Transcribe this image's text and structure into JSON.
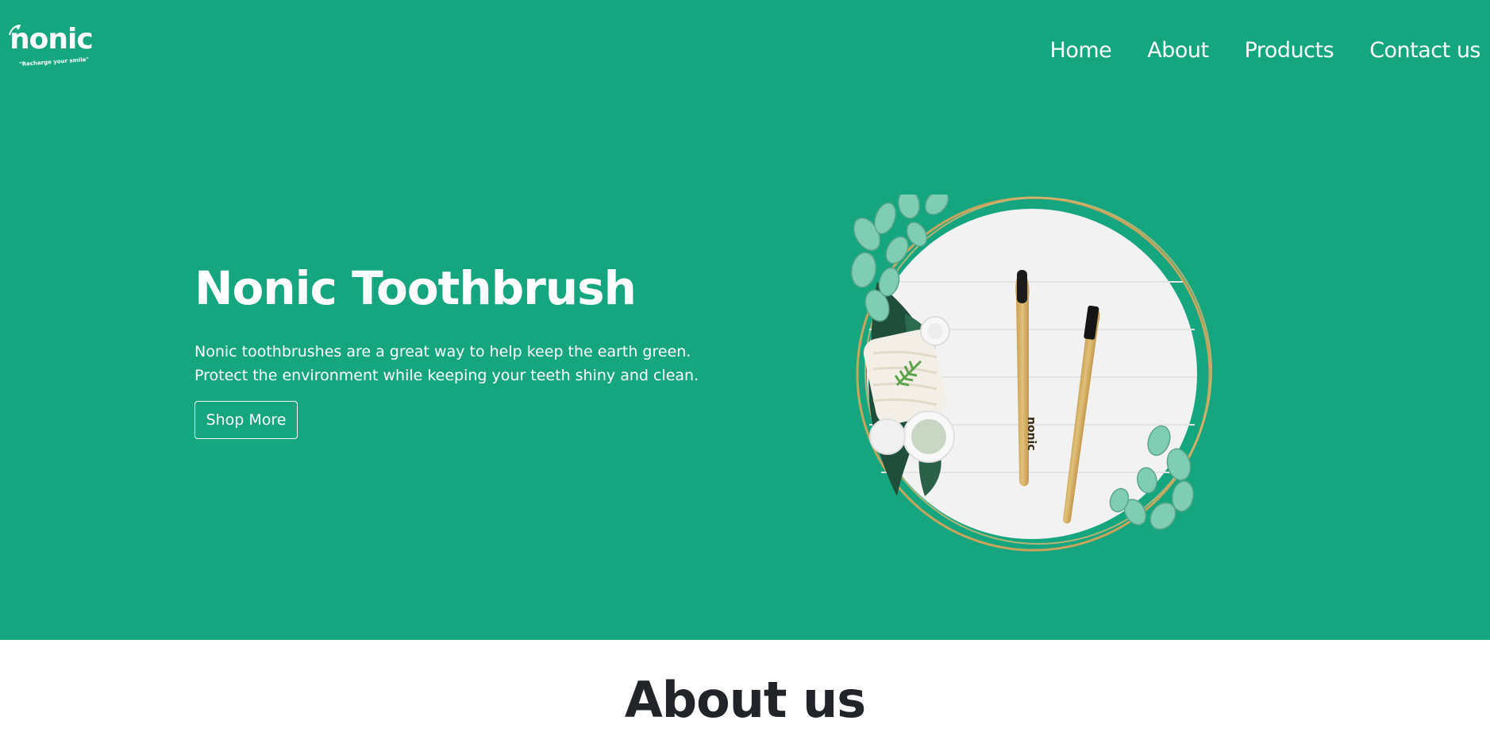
{
  "brand": {
    "name": "nonic",
    "tagline": "\"Recharge your smile\""
  },
  "nav": {
    "items": [
      {
        "label": "Home"
      },
      {
        "label": "About"
      },
      {
        "label": "Products"
      },
      {
        "label": "Contact us"
      }
    ]
  },
  "hero": {
    "title": "Nonic Toothbrush",
    "description": "Nonic toothbrushes are a great way to help keep the earth green. Protect the environment while keeping your teeth shiny and clean.",
    "button_label": "Shop More",
    "brush_print": "nonic"
  },
  "about": {
    "title": "About us"
  },
  "colors": {
    "primary": "#16a67f",
    "text_on_primary": "#ffffff",
    "heading_dark": "#212529",
    "ring_gold": "#c9a45c",
    "bamboo": "#d4b26a"
  }
}
